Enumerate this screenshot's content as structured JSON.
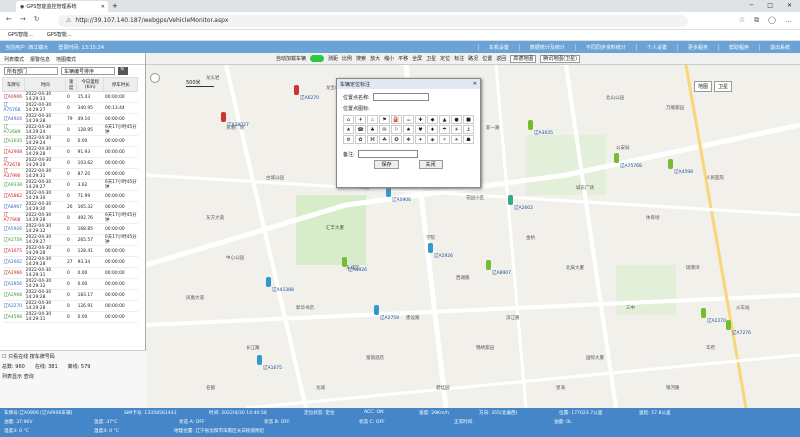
{
  "browser": {
    "tab_title": "GPS智能监控管理系统",
    "address": "http://39.107.140.187/webgps/VehicleMonitor.aspx",
    "bookmarks": [
      "GPS智能...",
      "GPS智能..."
    ]
  },
  "appbar": {
    "user": "当前用户: 西江镇大",
    "login_time": "登录时间: 13:15:24",
    "menu": [
      "车机设置",
      "数据统计及统计",
      "不同同步资料统计",
      "个人设置",
      "更多服务",
      "帮助程序",
      "退出系统"
    ]
  },
  "toolbar": {
    "auto_refresh": "自动加载车辆",
    "items": [
      "测距",
      "比例",
      "搜索",
      "放大",
      "缩小",
      "平移",
      "全屏",
      "卫星",
      "定位",
      "标注",
      "路况",
      "位置",
      "返回"
    ],
    "map_sel": "高德地图",
    "type_sel": "腾讯地图(卫星)"
  },
  "left": {
    "tabs": [
      "列表模式",
      "报警信息",
      "地图模式"
    ],
    "filter1": "所有部门",
    "filter2": "车辆编号排序",
    "columns": [
      "车牌号",
      "时间",
      "速度",
      "今日里程(Km)",
      "停车时长"
    ],
    "rows": [
      [
        "辽A0906",
        "2022-04-30 14:29:33",
        "0",
        "15.43",
        "00:00:00"
      ],
      [
        "辽A75768",
        "2022-04-30 14:29:27",
        "0",
        "340.95",
        "00:13:44"
      ],
      [
        "辽A4926",
        "2022-04-30 14:29:28",
        "79",
        "49.10",
        "00:00:00"
      ],
      [
        "辽A72689",
        "2022-04-30 14:29:24",
        "0",
        "128.95",
        "6天17小时45分钟"
      ],
      [
        "辽A3035",
        "2022-04-30 14:29:24",
        "0",
        "0.00",
        "00:00:00"
      ],
      [
        "辽A2908",
        "2022-04-30 14:29:28",
        "0",
        "91.93",
        "00:00:00"
      ],
      [
        "辽A72678",
        "2022-04-30 14:29:20",
        "0",
        "103.62",
        "00:00:00"
      ],
      [
        "辽A37990",
        "2022-04-30 14:29:31",
        "0",
        "87.20",
        "00:00:00"
      ],
      [
        "辽A9338",
        "2022-04-30 14:29:27",
        "0",
        "3.62",
        "6天17小时45分钟"
      ],
      [
        "辽A5862",
        "2022-04-30 14:29:30",
        "0",
        "71.99",
        "00:00:00"
      ],
      [
        "辽A8907",
        "2022-04-30 14:29:30",
        "26",
        "165.32",
        "00:00:00"
      ],
      [
        "辽A77908",
        "2022-04-30 14:29:28",
        "0",
        "492.76",
        "6天17小时45分钟"
      ],
      [
        "辽A5926",
        "2022-04-30 14:29:32",
        "0",
        "168.85",
        "00:00:00"
      ],
      [
        "辽A2759",
        "2022-04-30 14:29:27",
        "0",
        "265.57",
        "6天17小时45分钟"
      ],
      [
        "辽A1675",
        "2022-04-30 14:29:28",
        "0",
        "128.41",
        "00:00:00"
      ],
      [
        "辽A2602",
        "2022-04-30 14:29:28",
        "27",
        "93.34",
        "00:00:00"
      ],
      [
        "辽A2966",
        "2022-04-30 14:29:31",
        "0",
        "0.00",
        "00:00:00"
      ],
      [
        "辽A2856",
        "2022-04-30 14:29:32",
        "0",
        "0.00",
        "00:00:00"
      ],
      [
        "辽A2908",
        "2022-04-30 14:29:28",
        "0",
        "183.17",
        "00:00:00"
      ],
      [
        "辽A2270",
        "2022-04-30 14:29:28",
        "0",
        "126.91",
        "00:00:00"
      ],
      [
        "辽A4598",
        "2022-04-30 14:29:31",
        "0",
        "0.00",
        "00:00:00"
      ]
    ],
    "footer": {
      "sel_label": "只看在线",
      "opt": "按车牌号码",
      "count_total": "总数: 960",
      "count_online": "在线: 381",
      "count_offline": "离线: 579",
      "search_label": "列表显示  查询"
    }
  },
  "map": {
    "scale": "500米",
    "map_btn": "地图",
    "sat_btn": "卫星",
    "pois": [
      "龙头岩",
      "龙宝山",
      "科技城",
      "北山公园",
      "万顺家园",
      "东港广场",
      "和平",
      "新一路",
      "公安局",
      "古城公园",
      "中山路",
      "花园小区",
      "城东广场",
      "人民医院",
      "东方大道",
      "汇丰大厦",
      "学院",
      "金桥",
      "体育场",
      "中心公园",
      "东城区",
      "西湖路",
      "北辰大厦",
      "瑞港湾",
      "凤凰大道",
      "新华书店",
      "建设路",
      "滨江路",
      "三中",
      "火车站",
      "长江路",
      "富丽酒店",
      "锦绣家园",
      "国际大厦",
      "华府",
      "名都",
      "龙城",
      "碧桂园",
      "星海",
      "银河路"
    ],
    "cars": [
      "辽A6270",
      "辽A29027",
      "辽A0906",
      "辽A4598",
      "辽A3035",
      "辽A2602",
      "辽A5926",
      "辽A75768",
      "辽A4926",
      "辽A2759",
      "辽A1675",
      "辽A8907",
      "辽A7276",
      "辽A41388",
      "辽A2270"
    ]
  },
  "dialog": {
    "title": "车辆定位标注",
    "name_label": "位置点名称:",
    "icon_label": "位置点图标:",
    "note_label": "备注:",
    "save": "保存",
    "close": "关闭"
  },
  "status": {
    "row1": [
      "车牌号:辽A0906 [辽A0906车辆]",
      "SIM卡号: 13358561443",
      "时间: 2022/4/30 14:40:58",
      "定位状态: 定位",
      "ACC: ON",
      "速度: 29Km/h",
      "方向: 355(北偏西)",
      "位置: 177023.7公里",
      "里程: 57.8公里"
    ],
    "row2": [
      "油量: 37.96V",
      "温度: 37°C",
      "状态 A: OFF",
      "状态 B: OFF",
      "状态 C: OFF",
      "正常时间:",
      "",
      "油量: 0L"
    ],
    "row3": [
      "温度3: 0 °C",
      "温度4: 0 °C",
      "地理位置: 辽宁省沈阳市浑南区长白街道附近"
    ]
  },
  "colors": {
    "appbar": "#6ba3d6",
    "status": "#4586c8",
    "plate_red": "#cc2222",
    "plate_green": "#339933"
  }
}
